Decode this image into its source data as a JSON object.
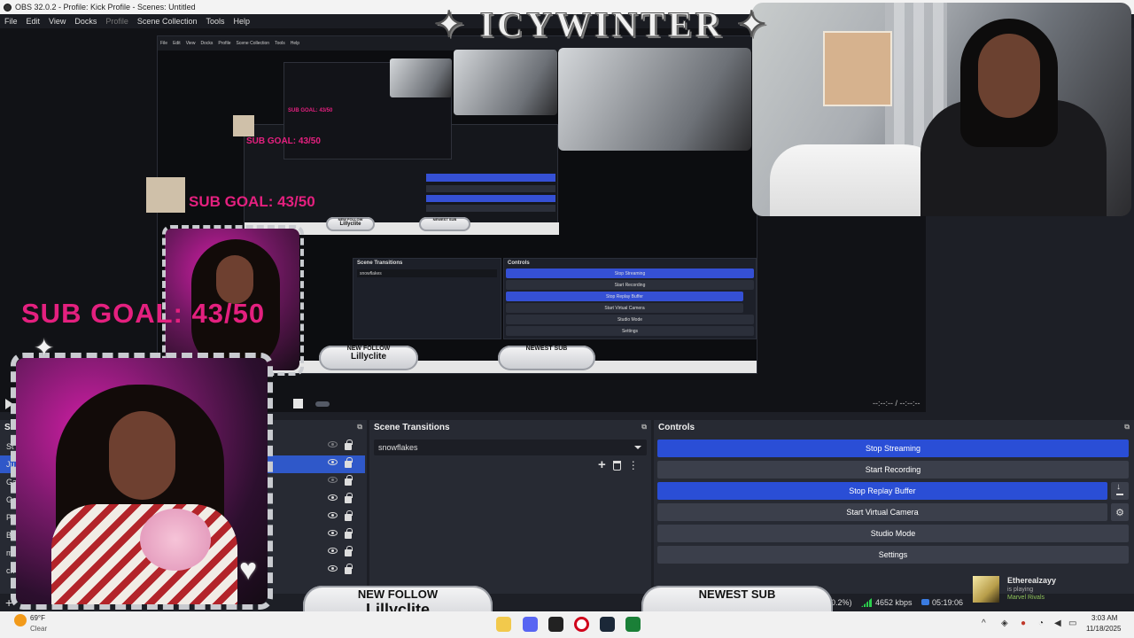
{
  "window": {
    "title": "OBS 32.0.2 - Profile: Kick Profile - Scenes: Untitled"
  },
  "menu": [
    "File",
    "Edit",
    "View",
    "Docks",
    "Profile",
    "Scene Collection",
    "Tools",
    "Help"
  ],
  "overlay": {
    "sub_goal": "SUB GOAL: 43/50",
    "sub_goal_mid": "SUB GOAL: 43/50",
    "sub_goal_sm": "SUB GOAL: 43/50",
    "new_follow_label": "NEW FOLLOW",
    "new_follow_name": "Lillyclite",
    "newest_sub_label": "NEWEST SUB",
    "newest_sub_name": ""
  },
  "preview": {
    "time_readout": "--:--:-- / --:--:--"
  },
  "scenes_dock": {
    "title": "Scenes",
    "rows": [
      {
        "label": "St"
      },
      {
        "label": "Ju"
      },
      {
        "label": "Ga"
      },
      {
        "label": "Ga"
      },
      {
        "label": "Pla"
      },
      {
        "label": "BR"
      },
      {
        "label": "ma"
      },
      {
        "label": "ch"
      }
    ]
  },
  "transitions_dock": {
    "title": "Scene Transitions",
    "selected": "snowflakes"
  },
  "controls_dock": {
    "title": "Controls",
    "buttons": {
      "stop_streaming": "Stop Streaming",
      "start_recording": "Start Recording",
      "stop_replay": "Stop Replay Buffer",
      "start_virtual_camera": "Start Virtual Camera",
      "studio_mode": "Studio Mode",
      "settings": "Settings"
    }
  },
  "status": {
    "dropped": "(0.2%)",
    "bitrate": "4652 kbps",
    "stream_time": "05:19:06"
  },
  "game_widget": {
    "user": "Etherealzayy",
    "activity": "is playing",
    "game": "Marvel Rivals"
  },
  "taskbar": {
    "temp": "69°F",
    "condition": "Clear",
    "time": "3:03 AM",
    "date": "11/18/2025"
  },
  "colors": {
    "accent_blue": "#2a4ed6",
    "sub_goal_pink": "#e4207f",
    "bitrate_green": "#2bd04d"
  },
  "icons": [
    "play-icon",
    "stop-icon",
    "eye-icon",
    "lock-icon",
    "plus-icon",
    "trash-icon",
    "kebab-icon",
    "download-icon",
    "gear-icon"
  ]
}
